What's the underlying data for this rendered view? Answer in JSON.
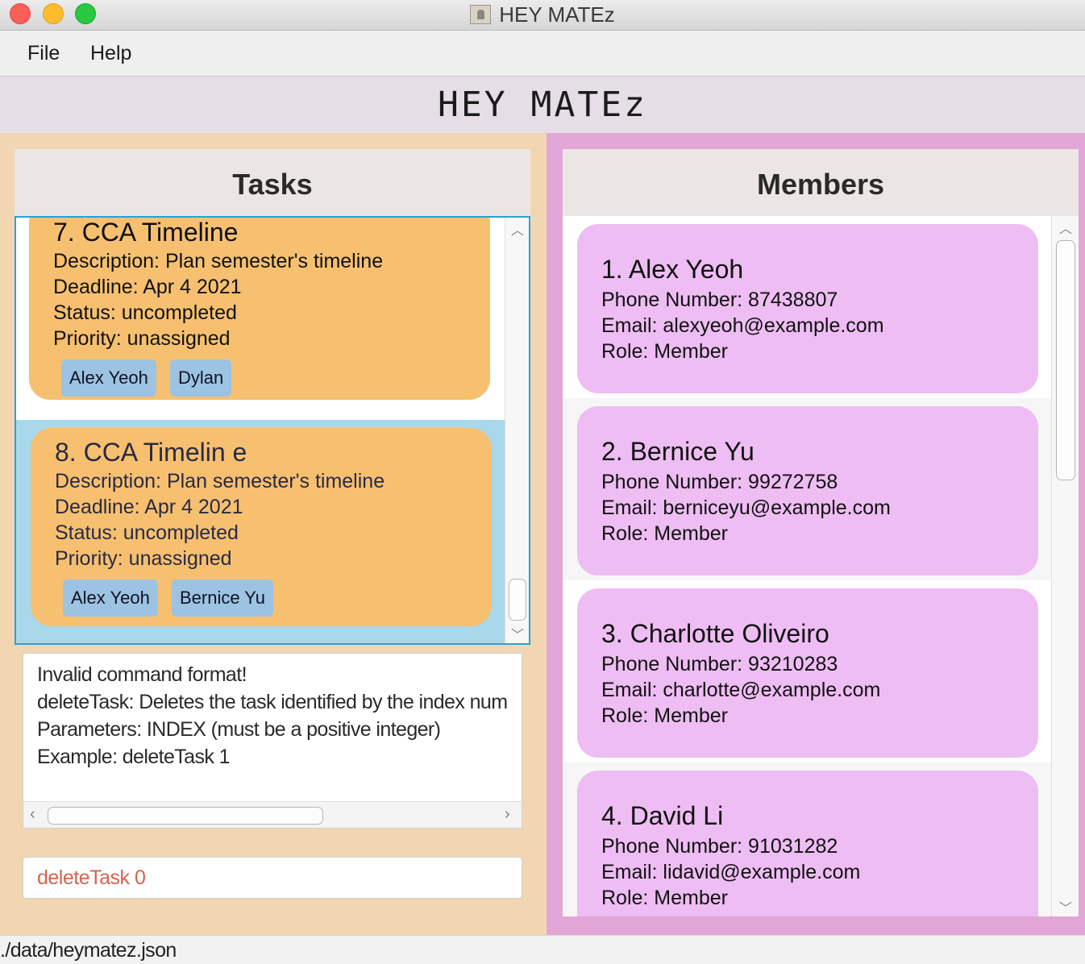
{
  "window": {
    "title": "HEY MATEz"
  },
  "menu": {
    "file": "File",
    "help": "Help"
  },
  "app_header": "HEY MATEz",
  "tasks_panel": {
    "title": "Tasks",
    "items": [
      {
        "title": "7.  CCA Timeline",
        "description": "Description: Plan semester's timeline",
        "deadline": "Deadline: Apr 4 2021",
        "status": "Status: uncompleted",
        "priority": "Priority: unassigned",
        "assignees": [
          "Alex Yeoh",
          "Dylan"
        ],
        "selected": false
      },
      {
        "title": "8.  CCA Timelin e",
        "description": "Description: Plan semester's timeline",
        "deadline": "Deadline: Apr 4 2021",
        "status": "Status: uncompleted",
        "priority": "Priority: unassigned",
        "assignees": [
          "Alex Yeoh",
          "Bernice Yu"
        ],
        "selected": true
      }
    ]
  },
  "result_display": {
    "lines": [
      "Invalid command format!",
      "deleteTask: Deletes the task identified by the index num",
      "Parameters: INDEX (must be a positive integer)",
      "Example: deleteTask 1"
    ]
  },
  "command_box": {
    "value": "deleteTask 0"
  },
  "members_panel": {
    "title": "Members",
    "items": [
      {
        "name": "1.  Alex Yeoh",
        "phone": "Phone Number: 87438807",
        "email": "Email: alexyeoh@example.com",
        "role": "Role: Member"
      },
      {
        "name": "2.  Bernice Yu",
        "phone": "Phone Number: 99272758",
        "email": "Email: berniceyu@example.com",
        "role": "Role: Member"
      },
      {
        "name": "3.  Charlotte Oliveiro",
        "phone": "Phone Number: 93210283",
        "email": "Email: charlotte@example.com",
        "role": "Role: Member"
      },
      {
        "name": "4.  David Li",
        "phone": "Phone Number: 91031282",
        "email": "Email: lidavid@example.com",
        "role": "Role: Member"
      }
    ]
  },
  "status_bar": {
    "path": "./data/heymatez.json"
  },
  "colors": {
    "tasks_bg": "#f1d6b1",
    "members_bg": "#e2a6d6",
    "task_card": "#f6c070",
    "member_card": "#eebdf3",
    "assignee_chip": "#9cc3e2",
    "selection": "#a8d8ea",
    "command_text": "#d7634d"
  },
  "icons": {
    "traffic_lights": [
      "close-icon",
      "minimize-icon",
      "zoom-icon"
    ],
    "app": "contacts-app-icon",
    "scroll_arrows": [
      "chevron-up-icon",
      "chevron-down-icon",
      "chevron-left-icon",
      "chevron-right-icon"
    ]
  }
}
